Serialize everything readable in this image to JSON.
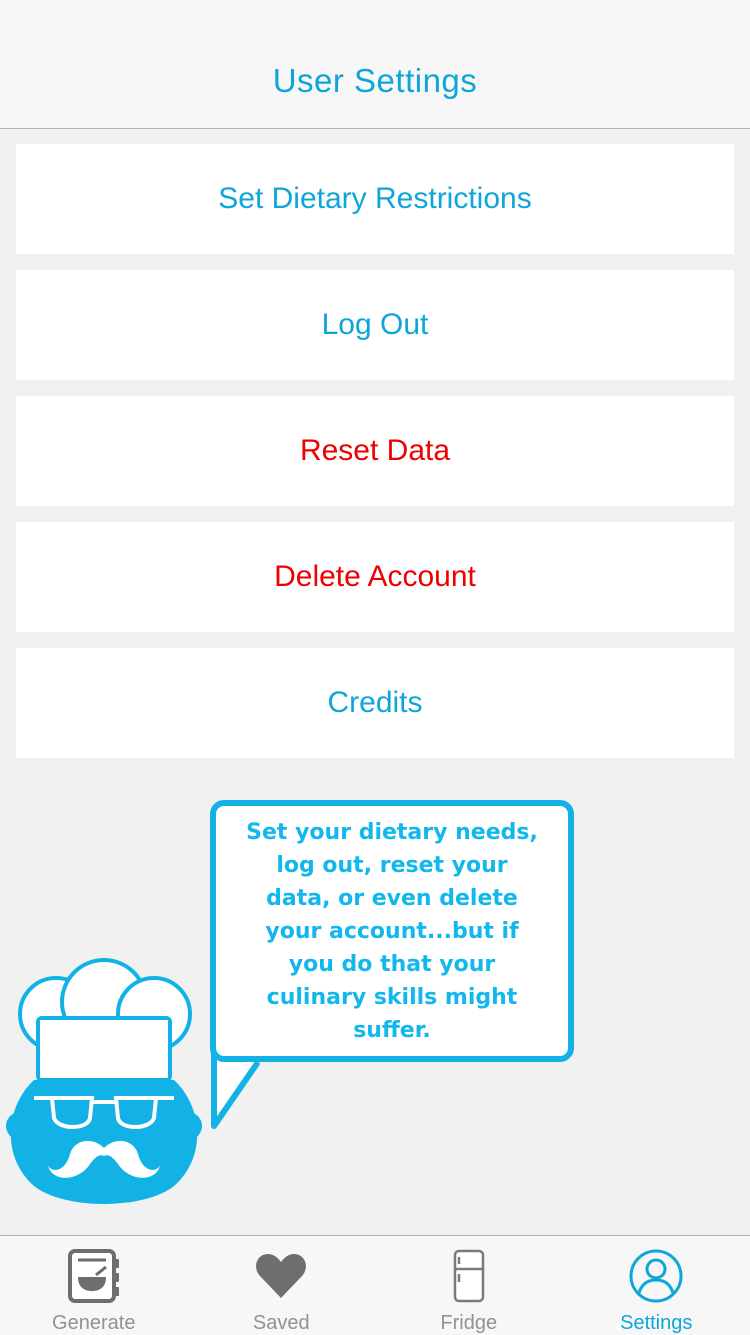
{
  "nav": {
    "title": "User Settings"
  },
  "menu": [
    {
      "label": "Set Dietary Restrictions",
      "tone": "blue"
    },
    {
      "label": "Log Out",
      "tone": "blue"
    },
    {
      "label": "Reset Data",
      "tone": "red"
    },
    {
      "label": "Delete Account",
      "tone": "red"
    },
    {
      "label": "Credits",
      "tone": "blue"
    }
  ],
  "bubble": {
    "text": "Set your dietary needs, log out, reset your data, or even delete your account...but if you do that your culinary skills might suffer."
  },
  "tabs": [
    {
      "label": "Generate",
      "icon": "cookbook-icon",
      "active": false
    },
    {
      "label": "Saved",
      "icon": "heart-icon",
      "active": false
    },
    {
      "label": "Fridge",
      "icon": "fridge-icon",
      "active": false
    },
    {
      "label": "Settings",
      "icon": "user-icon",
      "active": true
    }
  ],
  "colors": {
    "accent": "#0ea6d9",
    "danger": "#ee0000",
    "inactive_tab": "#929292",
    "background": "#f1f1f1"
  }
}
